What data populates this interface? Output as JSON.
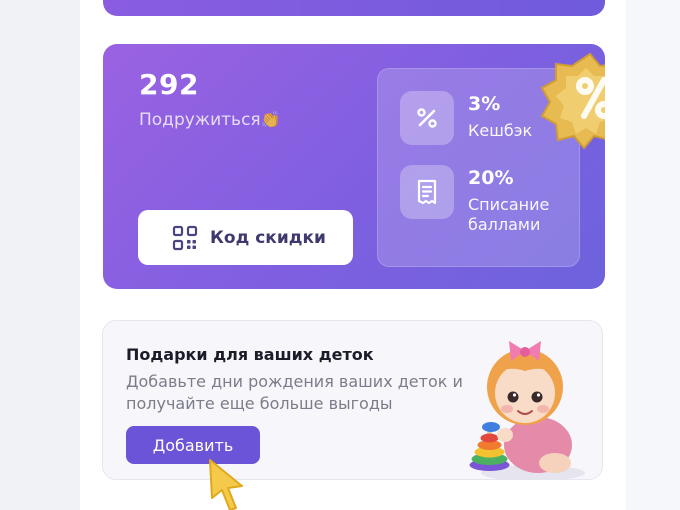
{
  "loyalty": {
    "points": "292",
    "status": "Подружиться",
    "status_emoji": "👏",
    "code_button_label": "Код скидки",
    "benefits": [
      {
        "value": "3%",
        "label": "Кешбэк",
        "icon": "percent-icon"
      },
      {
        "value": "20%",
        "label": "Списание баллами",
        "icon": "receipt-icon"
      }
    ]
  },
  "kids_promo": {
    "title": "Подарки для ваших деток",
    "description": "Добавьте дни рождения ваших деток и получайте еще больше выгоды",
    "button_label": "Добавить",
    "image": "baby-with-ring-pyramid"
  },
  "colors": {
    "card_gradient_start": "#9a62e2",
    "card_gradient_end": "#6d63dc",
    "accent_button": "#6b54d8",
    "badge_gold": "#e7bb52"
  }
}
